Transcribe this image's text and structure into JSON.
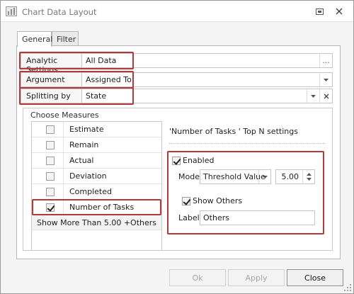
{
  "window": {
    "title": "Chart Data Layout"
  },
  "tabs": [
    {
      "label": "General"
    },
    {
      "label": "Filter"
    }
  ],
  "fields": {
    "analytic": {
      "label": "Analytic Settings",
      "value": "All Data",
      "button": "..."
    },
    "argument": {
      "label": "Argument",
      "value": "Assigned To"
    },
    "splitting": {
      "label": "Splitting by",
      "value": "State"
    }
  },
  "measures": {
    "group_title": "Choose Measures",
    "items": [
      {
        "label": "Estimate",
        "checked": false
      },
      {
        "label": "Remain",
        "checked": false
      },
      {
        "label": "Actual",
        "checked": false
      },
      {
        "label": "Deviation",
        "checked": false
      },
      {
        "label": "Completed",
        "checked": false
      },
      {
        "label": "Number of Tasks",
        "checked": true
      }
    ],
    "show_more": "Show More Than 5.00 +Others"
  },
  "topn": {
    "title": "'Number of Tasks ' Top N settings",
    "enabled_label": "Enabled",
    "enabled": true,
    "mode_label": "Mode",
    "mode_value": "Threshold Value",
    "threshold_value": "5.00",
    "show_others_label": "Show Others",
    "show_others": true,
    "label_label": "Label",
    "label_value": "Others"
  },
  "buttons": {
    "ok": "Ok",
    "apply": "Apply",
    "close": "Close"
  },
  "colors": {
    "highlight_red": "#b33a3a"
  }
}
